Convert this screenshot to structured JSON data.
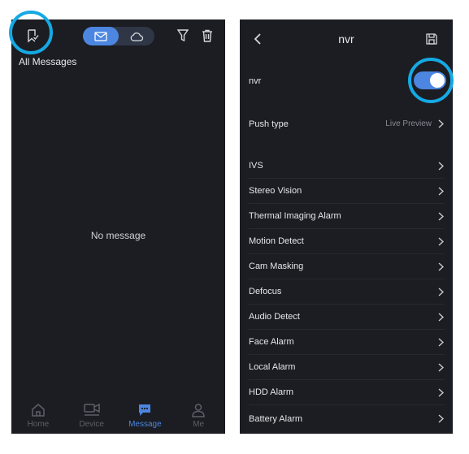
{
  "left_screen": {
    "section_title": "All Messages",
    "empty_text": "No message",
    "tabs": [
      {
        "label": "Home",
        "icon": "home-icon"
      },
      {
        "label": "Device",
        "icon": "device-icon"
      },
      {
        "label": "Message",
        "icon": "message-icon",
        "active": true
      },
      {
        "label": "Me",
        "icon": "person-icon"
      }
    ]
  },
  "right_screen": {
    "title": "nvr",
    "device_toggle_label": "nvr",
    "device_toggle_on": true,
    "push_type_label": "Push type",
    "push_type_value": "Live Preview",
    "alarm_items": [
      "IVS",
      "Stereo Vision",
      "Thermal Imaging Alarm",
      "Motion Detect",
      "Cam Masking",
      "Defocus",
      "Audio Detect",
      "Face Alarm",
      "Local Alarm",
      "HDD Alarm",
      "Battery Alarm"
    ]
  },
  "colors": {
    "background": "#1b1d22",
    "accent": "#4c86e0",
    "highlight": "#15a9e4"
  }
}
